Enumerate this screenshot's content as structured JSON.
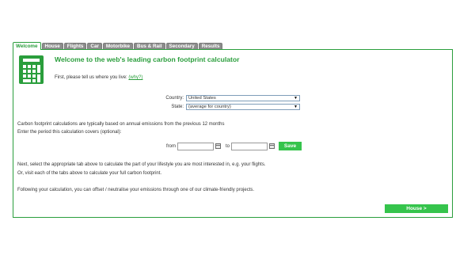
{
  "tabs": [
    {
      "label": "Welcome",
      "active": true
    },
    {
      "label": "House",
      "active": false
    },
    {
      "label": "Flights",
      "active": false
    },
    {
      "label": "Car",
      "active": false
    },
    {
      "label": "Motorbike",
      "active": false
    },
    {
      "label": "Bus & Rail",
      "active": false
    },
    {
      "label": "Secondary",
      "active": false
    },
    {
      "label": "Results",
      "active": false
    }
  ],
  "header": {
    "title": "Welcome to the web's leading carbon footprint calculator",
    "icon": "calculator-icon"
  },
  "intro": {
    "text": "First, please tell us where you live:",
    "why_link": "(why?)"
  },
  "location": {
    "country_label": "Country:",
    "country_value": "United States",
    "state_label": "State:",
    "state_value": "(average for country)"
  },
  "period": {
    "line1": "Carbon footprint calculations are typically based on annual emissions from the previous 12 months",
    "line2": "Enter the period this calculation covers (optional):",
    "from_label": "from",
    "to_label": "to",
    "from_value": "",
    "to_value": "",
    "save_label": "Save"
  },
  "instructions": {
    "line1": "Next, select the appropriate tab above to calculate the part of your lifestyle you are most interested in, e.g. your flights.",
    "line2": "Or, visit each of the tabs above to calculate your full carbon footprint.",
    "line3": "Following your calculation, you can offset / neutralise your emissions through one of our climate-friendly projects."
  },
  "nav": {
    "next_label": "House >"
  },
  "colors": {
    "accent": "#2a9e3c",
    "button": "#35c44c",
    "tab_inactive": "#8c8c8c"
  }
}
